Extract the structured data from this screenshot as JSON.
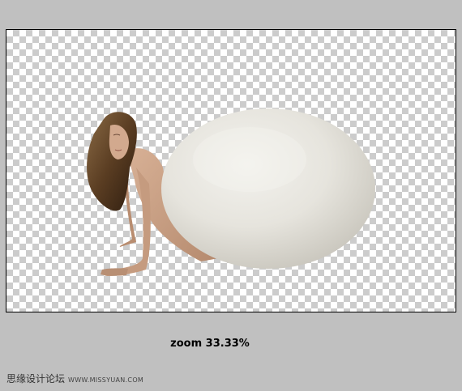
{
  "zoom": {
    "label": "zoom 33.33%"
  },
  "watermark": {
    "site_name": "思缘设计论坛",
    "url": "WWW.MISSYUAN.COM"
  },
  "canvas": {
    "background": "transparency-checkerboard"
  },
  "colors": {
    "workspace": "#c0c0c0",
    "checker_dark": "#cccccc",
    "checker_light": "#ffffff",
    "egg": "#e8e6e0",
    "skin": "#c9a088",
    "hair": "#6b4a2a"
  }
}
